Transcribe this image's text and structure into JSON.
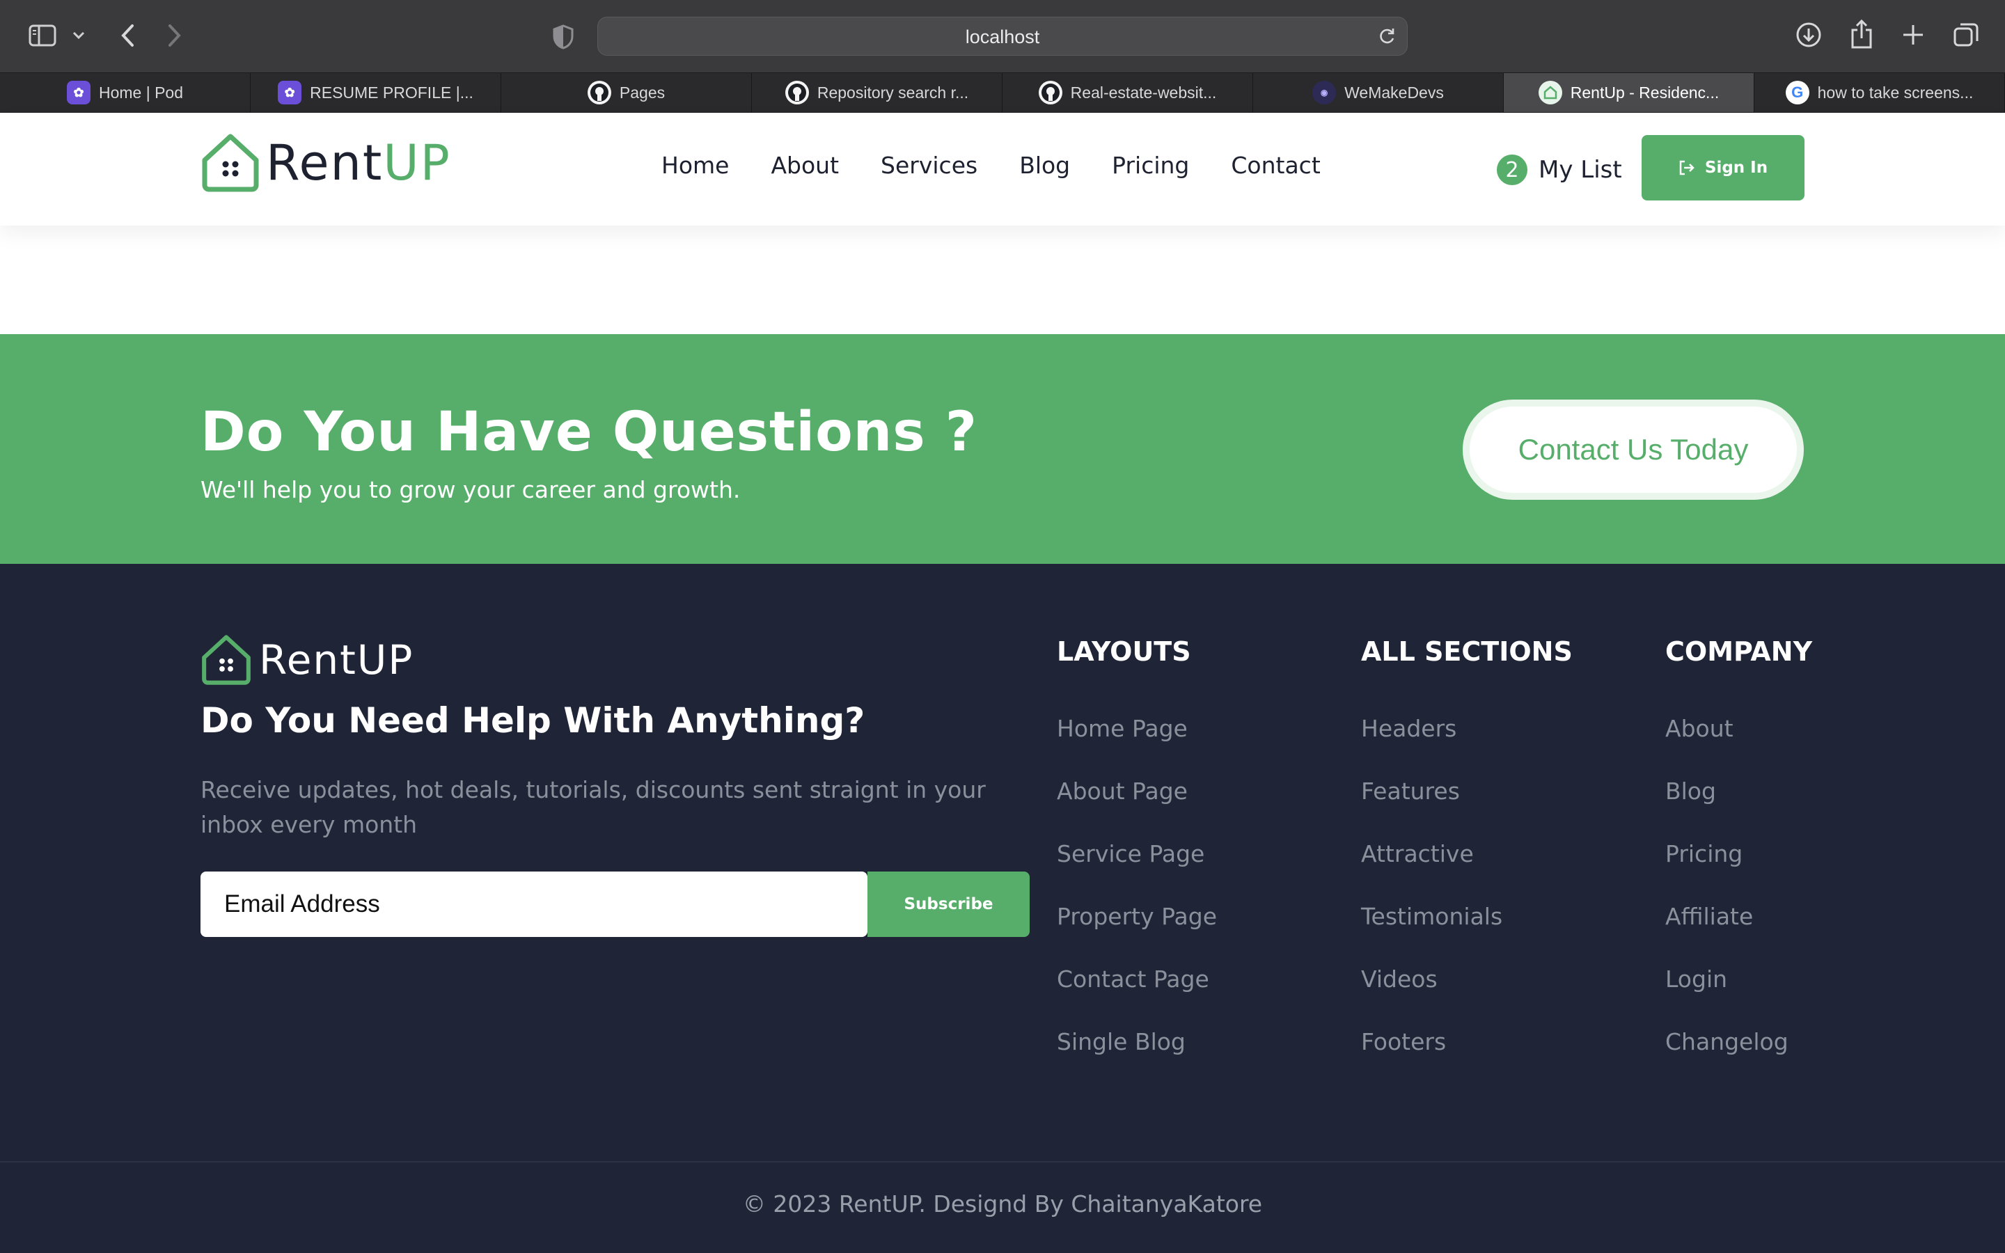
{
  "browser": {
    "url": "localhost",
    "tabs": [
      {
        "label": "Home | Pod",
        "favicon": "pod-icon"
      },
      {
        "label": "RESUME PROFILE |...",
        "favicon": "pod-icon"
      },
      {
        "label": "Pages",
        "favicon": "github-icon"
      },
      {
        "label": "Repository search r...",
        "favicon": "github-icon"
      },
      {
        "label": "Real-estate-websit...",
        "favicon": "github-icon"
      },
      {
        "label": "WeMakeDevs",
        "favicon": "wemakedevs-icon"
      },
      {
        "label": "RentUp - Residenc...",
        "favicon": "rentup-icon",
        "active": true
      },
      {
        "label": "how to take screens...",
        "favicon": "google-icon"
      }
    ]
  },
  "header": {
    "logo": {
      "part1": "Rent",
      "part2": "UP"
    },
    "nav": [
      "Home",
      "About",
      "Services",
      "Blog",
      "Pricing",
      "Contact"
    ],
    "my_list": {
      "count": "2",
      "label": "My List"
    },
    "sign_in": "Sign In"
  },
  "cta": {
    "title": "Do You Have Questions ?",
    "subtitle": "We'll help you to grow your career and growth.",
    "button": "Contact Us Today"
  },
  "footer": {
    "logo": "RentUP",
    "heading": "Do You Need Help With Anything?",
    "text": "Receive updates, hot deals, tutorials, discounts sent straignt in your inbox every month",
    "email_placeholder": "Email Address",
    "subscribe": "Subscribe",
    "columns": [
      {
        "title": "LAYOUTS",
        "links": [
          "Home Page",
          "About Page",
          "Service Page",
          "Property Page",
          "Contact Page",
          "Single Blog"
        ]
      },
      {
        "title": "ALL SECTIONS",
        "links": [
          "Headers",
          "Features",
          "Attractive",
          "Testimonials",
          "Videos",
          "Footers"
        ]
      },
      {
        "title": "COMPANY",
        "links": [
          "About",
          "Blog",
          "Pricing",
          "Affiliate",
          "Login",
          "Changelog"
        ]
      }
    ],
    "copyright": "© 2023 RentUP. Designd By ChaitanyaKatore"
  },
  "colors": {
    "brand_green": "#57ae6a",
    "footer_bg": "#1f2436",
    "text_dark": "#1d2130",
    "muted": "#8b909c"
  }
}
